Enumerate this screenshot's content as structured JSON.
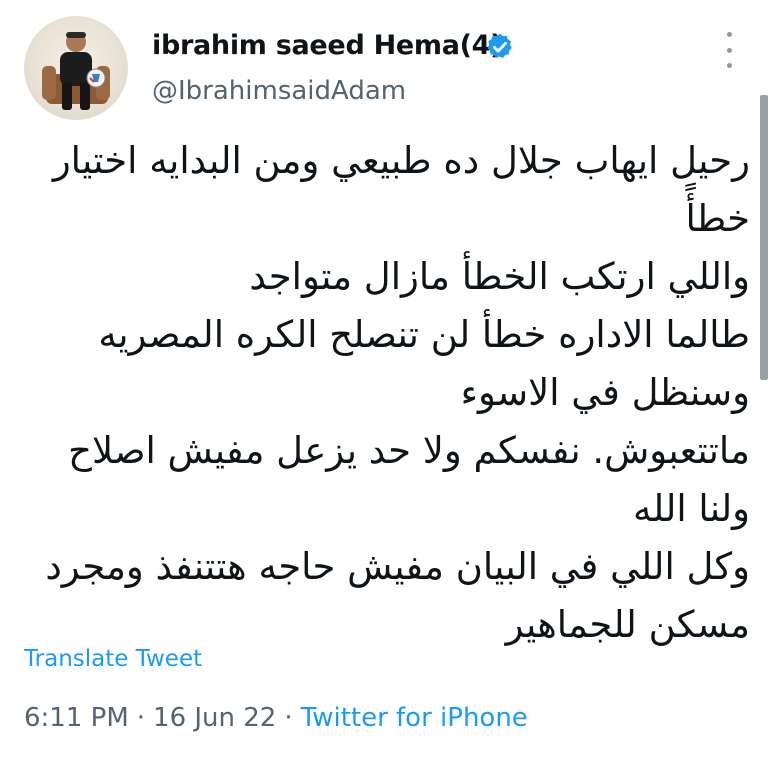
{
  "user": {
    "display_name": "ibrahim saeed Hema(4)",
    "handle": "@IbrahimsaidAdam",
    "verified_icon": "verified-badge-icon",
    "avatar_icon": "profile-photo"
  },
  "menu": {
    "icon": "more-options-icon"
  },
  "tweet": {
    "lines": [
      "رحيل ايهاب جلال ده طبيعي ومن البدايه اختيار",
      "خطأً",
      "واللي ارتكب الخطأ مازال متواجد",
      "طالما الاداره خطأ لن تنصلح الكره المصريه",
      "وسنظل في الاسوء",
      "ماتتعبوش. نفسكم ولا حد يزعل مفيش اصلاح",
      "ولنا الله",
      "وكل اللي في البيان مفيش حاجه هتتنفذ ومجرد",
      "مسكن للجماهير"
    ],
    "translate_label": "Translate Tweet",
    "time": "6:11 PM",
    "date": "16 Jun 22",
    "source": "Twitter for iPhone",
    "separator": "·"
  },
  "colors": {
    "link": "#1d9bf0",
    "secondary_text": "#536471",
    "primary_text": "#0f1419"
  }
}
